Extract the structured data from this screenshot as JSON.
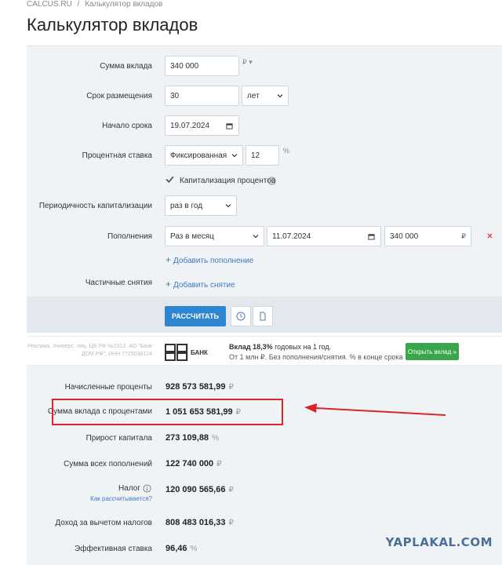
{
  "breadcrumb": {
    "home": "CALCUS.RU",
    "sep": "/",
    "current": "Калькулятор вкладов"
  },
  "title": "Калькулятор вкладов",
  "form": {
    "deposit_sum": {
      "label": "Сумма вклада",
      "value": "340 000",
      "currency": "₽ ▾"
    },
    "term": {
      "label": "Срок размещения",
      "value": "30",
      "unit_select": "лет"
    },
    "start": {
      "label": "Начало срока",
      "value": "19.07.2024"
    },
    "rate": {
      "label": "Процентная ставка",
      "type_select": "Фиксированная",
      "value": "12",
      "unit": "%"
    },
    "capitalization": {
      "checkbox_label": "Капитализация процентов",
      "checked": true
    },
    "periodicity": {
      "label": "Периодичность капитализации",
      "value": "раз в год"
    },
    "replenishment": {
      "label": "Пополнения",
      "frequency": "Раз в месяц",
      "date": "11.07.2024",
      "amount": "340 000",
      "currency": "₽",
      "add_link": "Добавить пополнение"
    },
    "withdrawals": {
      "label": "Частичные снятия",
      "add_link": "Добавить снятие"
    }
  },
  "actions": {
    "calculate": "РАССЧИТАТЬ"
  },
  "ad": {
    "legal": "Реклама. Универс. лиц. ЦБ РФ №2312. АО \"Банк ДОМ.РФ\", ИНН 7725038124",
    "bank": "БАНК",
    "title_prefix": "Вклад ",
    "title_bold": "18,3%",
    "title_suffix": " годовых на 1 год.",
    "subtitle": "От 1 млн ₽. Без пополнения/снятия. % в конце срока",
    "button": "Открыть вклад »"
  },
  "results": [
    {
      "label": "Начисленные проценты",
      "value": "928 573 581,99",
      "unit": "₽"
    },
    {
      "label": "Сумма вклада с процентами",
      "value": "1 051 653 581,99",
      "unit": "₽"
    },
    {
      "label": "Прирост капитала",
      "value": "273 109,88",
      "unit": "%"
    },
    {
      "label": "Сумма всех пополнений",
      "value": "122 740 000",
      "unit": "₽"
    },
    {
      "label": "Налог",
      "value": "120 090 565,66",
      "unit": "₽",
      "link": "Как рассчитывается?"
    },
    {
      "label": "Доход за вычетом налогов",
      "value": "808 483 016,33",
      "unit": "₽"
    },
    {
      "label": "Эффективная ставка",
      "value": "96,46",
      "unit": "%"
    }
  ],
  "watermark": "YAPLAKAL.COM",
  "colors": {
    "accent": "#2f86d0",
    "highlight": "#d8262b",
    "ad_button": "#3aa64c"
  }
}
